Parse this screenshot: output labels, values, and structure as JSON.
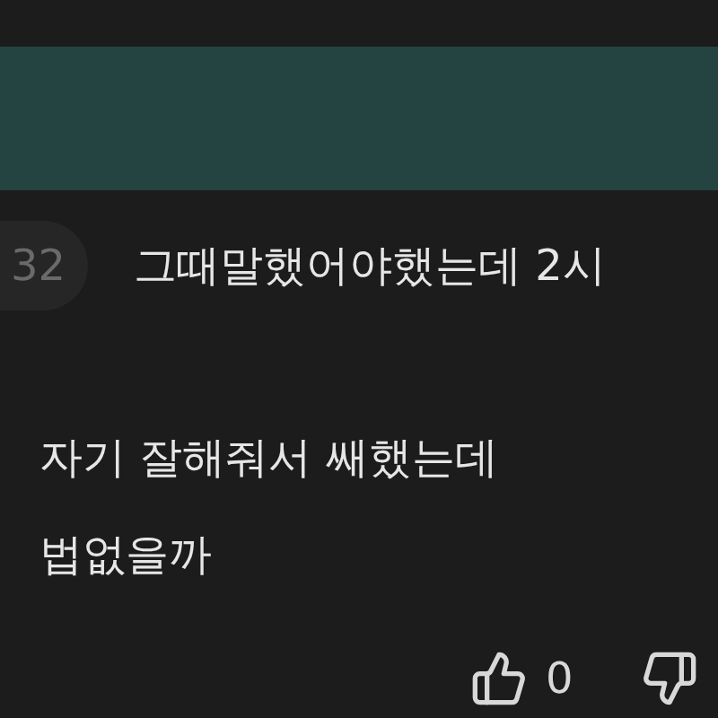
{
  "reply_count": "32",
  "comment_lines": [
    "그때말했어야했는데 2시",
    "자기 잘해줘서 쌔했는데",
    "법없을까"
  ],
  "like_count": "0"
}
